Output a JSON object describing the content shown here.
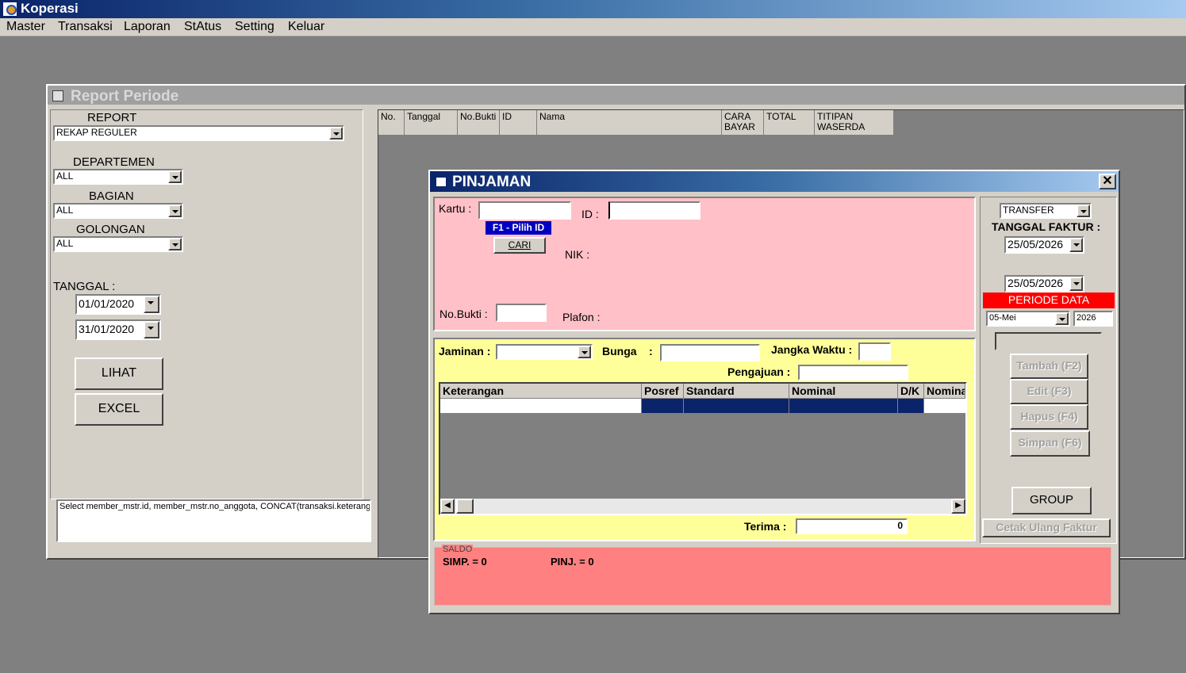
{
  "app": {
    "title": "Koperasi"
  },
  "menu": [
    "Master",
    "Transaksi",
    "Laporan",
    "StAtus",
    "Setting",
    "Keluar"
  ],
  "report_window": {
    "title": "Report Periode",
    "report_label": "REPORT",
    "report_value": "REKAP REGULER",
    "departemen_label": "DEPARTEMEN",
    "departemen_value": "ALL",
    "bagian_label": "BAGIAN",
    "bagian_value": "ALL",
    "golongan_label": "GOLONGAN",
    "golongan_value": "ALL",
    "tanggal_label": "TANGGAL :",
    "date_from": "01/01/2020",
    "date_to": "31/01/2020",
    "lihat_label": "LIHAT",
    "excel_label": "EXCEL",
    "sql_text": "Select member_mstr.id, member_mstr.no_anggota, CONCAT(transaksi.keterangan,",
    "columns": [
      "No.",
      "Tanggal",
      "No.Bukti",
      "ID",
      "Nama",
      "CARA BAYAR",
      "TOTAL",
      "TITIPAN WASERDA"
    ]
  },
  "pinjaman": {
    "title": "PINJAMAN",
    "kartu_label": "Kartu :",
    "kartu_value": "",
    "id_label": "ID :",
    "id_value": "",
    "f1_label": "F1 - Pilih ID",
    "cari_label": "CARI",
    "nik_label": "NIK :",
    "nobukti_label": "No.Bukti :",
    "nobukti_value": "",
    "plafon_label": "Plafon :",
    "jaminan_label": "Jaminan :",
    "jaminan_value": "",
    "bunga_label": "Bunga",
    "bunga_colon": ":",
    "bunga_value": "",
    "jangka_label": "Jangka Waktu :",
    "jangka_value": "",
    "pengajuan_label": "Pengajuan :",
    "pengajuan_value": "",
    "grid_columns": [
      "Keterangan",
      "Posref",
      "Standard",
      "Nominal",
      "D/K",
      "Nomina"
    ],
    "terima_label": "Terima :",
    "terima_value": "0",
    "saldo_label": "SALDO",
    "simp_text": "SIMP. = 0",
    "pinj_text": "PINJ. = 0",
    "transfer_value": "TRANSFER",
    "tanggal_faktur_label": "TANGGAL  FAKTUR :",
    "tanggal_faktur_value": "25/05/2026",
    "date2_value": "25/05/2026",
    "periode_data_label": "PERIODE DATA",
    "periode_month": "05-Mei",
    "periode_year": "2026",
    "tambah_label": "Tambah (F2)",
    "edit_label": "Edit (F3)",
    "hapus_label": "Hapus (F4)",
    "simpan_label": "Simpan (F6)",
    "group_label": "GROUP",
    "cetak_label": "Cetak Ulang Faktur"
  },
  "colors": {
    "pink_panel": "#ffc0c8",
    "yellow_panel": "#ffff99",
    "saldo_panel": "#ff8080",
    "periode_red": "#ff0000",
    "f1_blue": "#0000c0",
    "grid_selected": "#0a246a"
  }
}
